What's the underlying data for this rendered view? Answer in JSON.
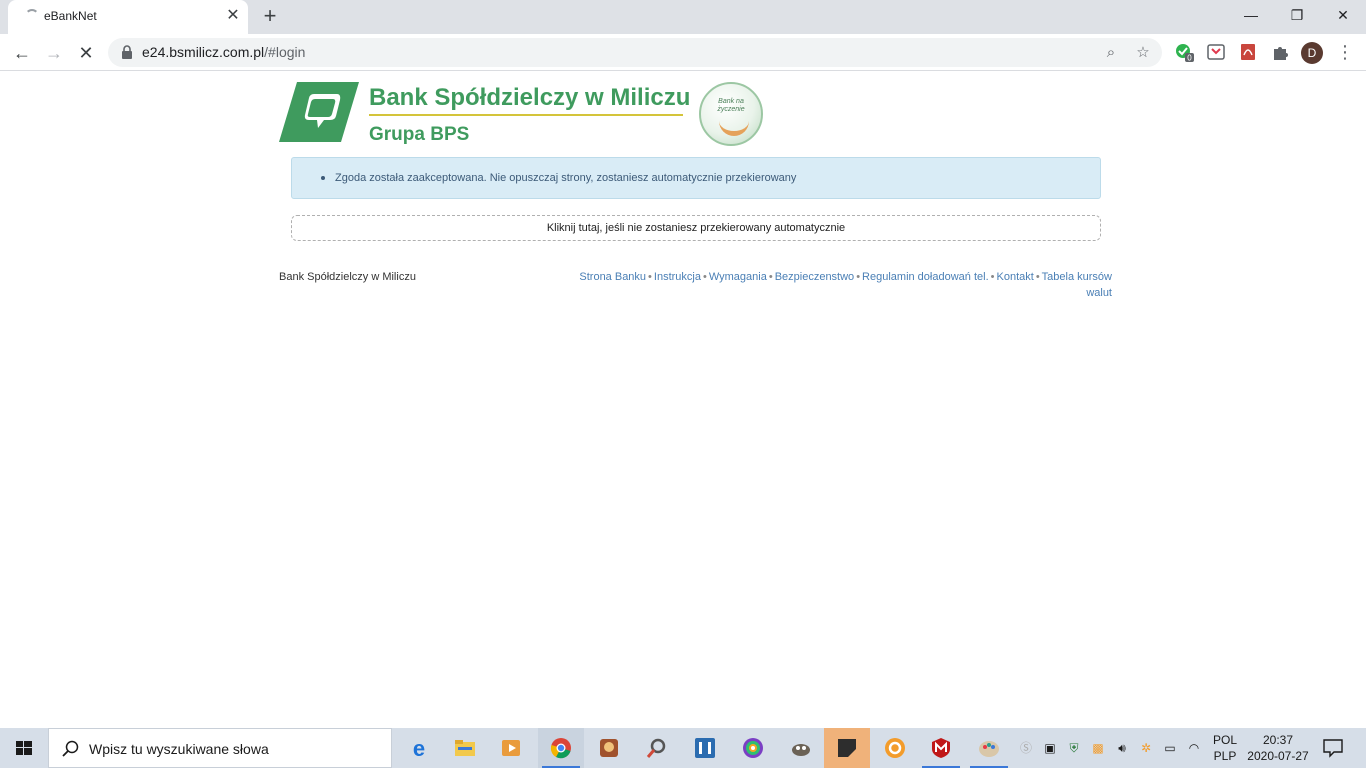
{
  "browser": {
    "tab_title": "eBankNet",
    "tab_close": "✕",
    "new_tab": "+",
    "url_host": "e24.bsmilicz.com.pl",
    "url_path": "/#login",
    "window_buttons": {
      "minimize": "—",
      "restore": "❐",
      "close": "✕"
    },
    "profile_initial": "D",
    "extension_badge": "0"
  },
  "page": {
    "logo": {
      "title": "Bank Spółdzielczy w Miliczu",
      "subtitle": "Grupa BPS",
      "badge_text": "Bank na życzenie"
    },
    "alert_message": "Zgoda została zaakceptowana. Nie opuszczaj strony, zostaniesz automatycznie przekierowany",
    "redirect_link": "Kliknij tutaj, jeśli nie zostaniesz przekierowany automatycznie",
    "footer": {
      "bank_name": "Bank Spółdzielczy w Miliczu",
      "links": [
        "Strona Banku",
        "Instrukcja",
        "Wymagania",
        "Bezpieczenstwo",
        "Regulamin doładowań tel.",
        "Kontakt",
        "Tabela kursów walut"
      ],
      "separator": "•"
    }
  },
  "taskbar": {
    "search_placeholder": "Wpisz tu wyszukiwane słowa",
    "language": [
      "POL",
      "PLP"
    ],
    "time": "20:37",
    "date": "2020-07-27",
    "apps": [
      "edge",
      "file-explorer",
      "media-player",
      "chrome",
      "game",
      "search-tool",
      "app-bracket",
      "photos",
      "gimp",
      "sticky-notes",
      "settings-gear",
      "mcafee",
      "paint"
    ],
    "active_app": "sticky-notes"
  },
  "colors": {
    "brand_green": "#3f9b5e",
    "brand_yellow": "#d4c43a",
    "alert_bg": "#d9ecf6",
    "link_blue": "#4a7fb5"
  }
}
